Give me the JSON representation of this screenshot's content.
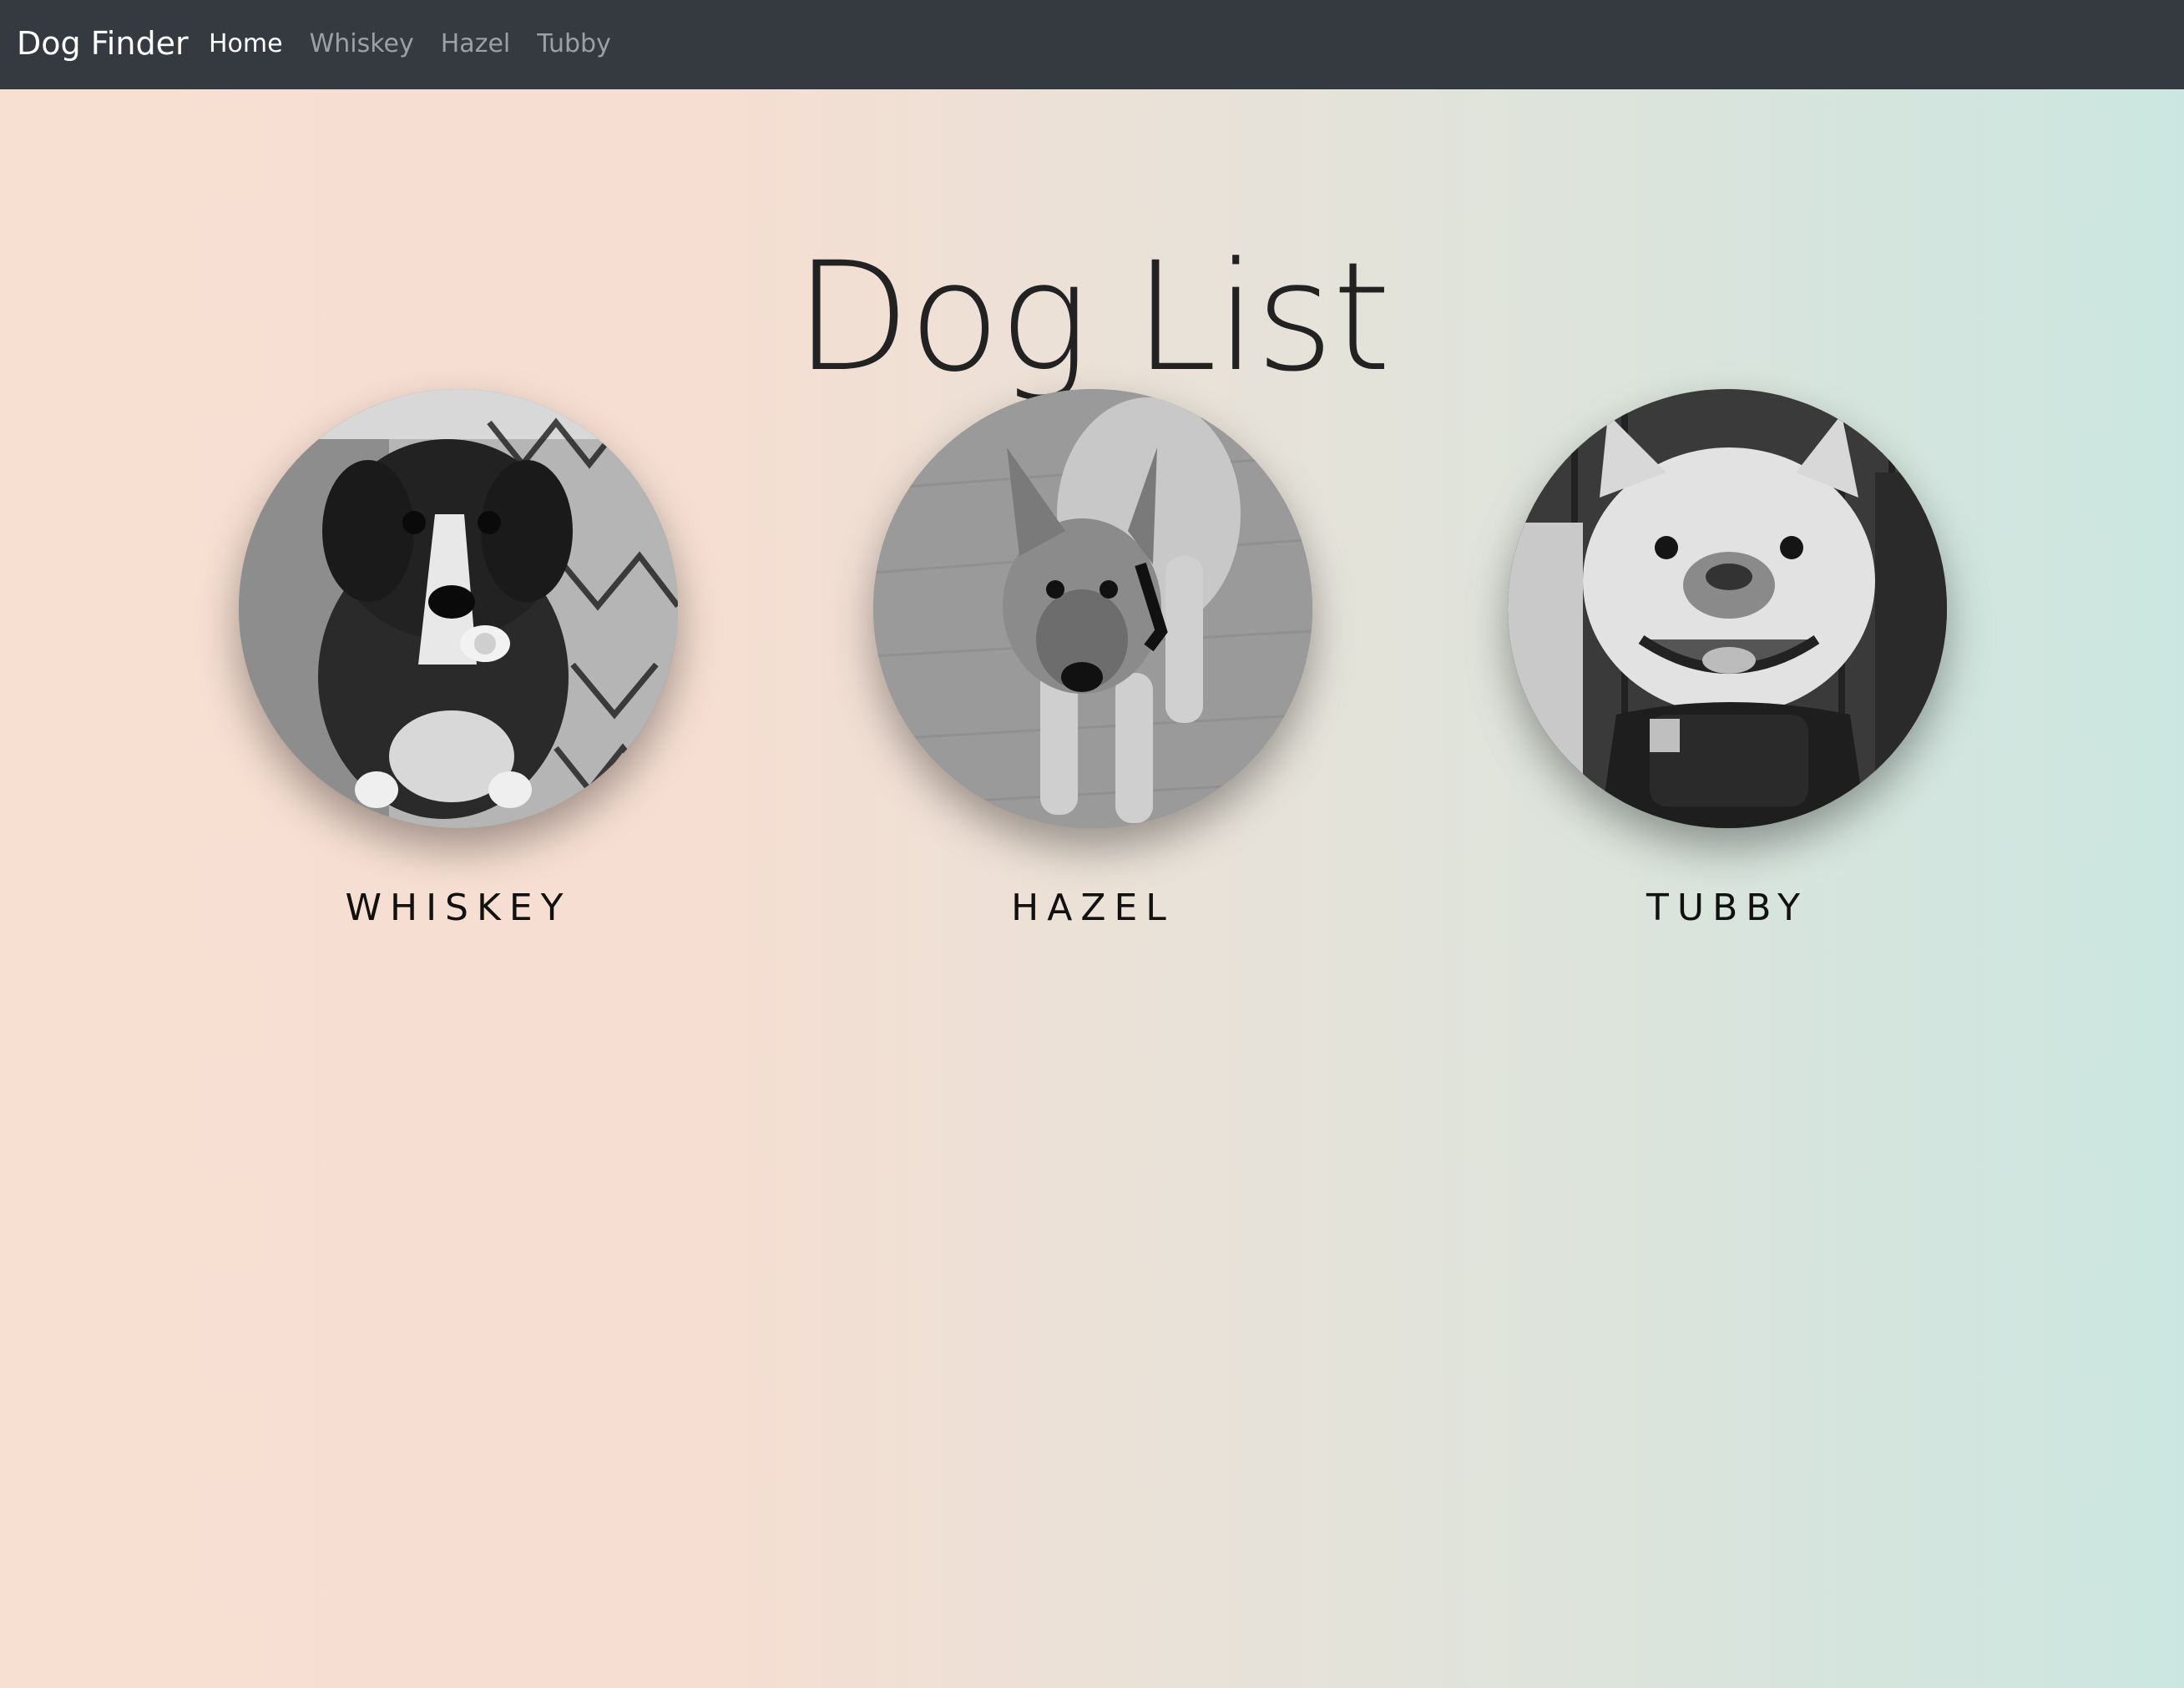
{
  "navbar": {
    "brand": "Dog Finder",
    "links": [
      {
        "label": "Home",
        "active": true
      },
      {
        "label": "Whiskey",
        "active": false
      },
      {
        "label": "Hazel",
        "active": false
      },
      {
        "label": "Tubby",
        "active": false
      }
    ]
  },
  "main": {
    "title": "Dog List",
    "dogs": [
      {
        "name": "WHISKEY",
        "photo_icon": "dog-photo-whiskey"
      },
      {
        "name": "HAZEL",
        "photo_icon": "dog-photo-hazel"
      },
      {
        "name": "TUBBY",
        "photo_icon": "dog-photo-tubby"
      }
    ]
  },
  "colors": {
    "navbar_bg": "#343a40",
    "gradient_left": "#f7dfd2",
    "gradient_right": "#cbe6e0"
  }
}
